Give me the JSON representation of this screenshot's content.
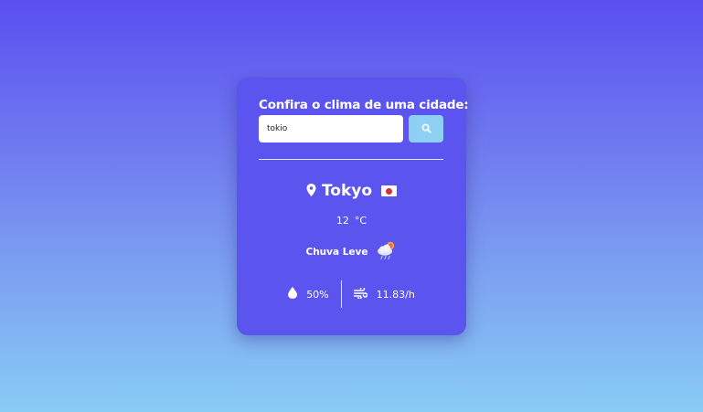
{
  "form": {
    "title": "Confira o clima de uma cidade:",
    "search_value": "tokio",
    "search_icon": "search-icon"
  },
  "weather": {
    "city": "Tokyo",
    "country_flag": "jp-flag",
    "location_icon": "location-pin-icon",
    "temperature": "12",
    "unit": "°C",
    "description": "Chuva Leve",
    "weather_icon": "light-rain-icon",
    "humidity": "50%",
    "humidity_icon": "water-drop-icon",
    "wind": "11.83/h",
    "wind_icon": "wind-icon"
  },
  "colors": {
    "card": "#5c54ee",
    "button": "#8dd0f4",
    "flag_red": "#d32f3c"
  }
}
